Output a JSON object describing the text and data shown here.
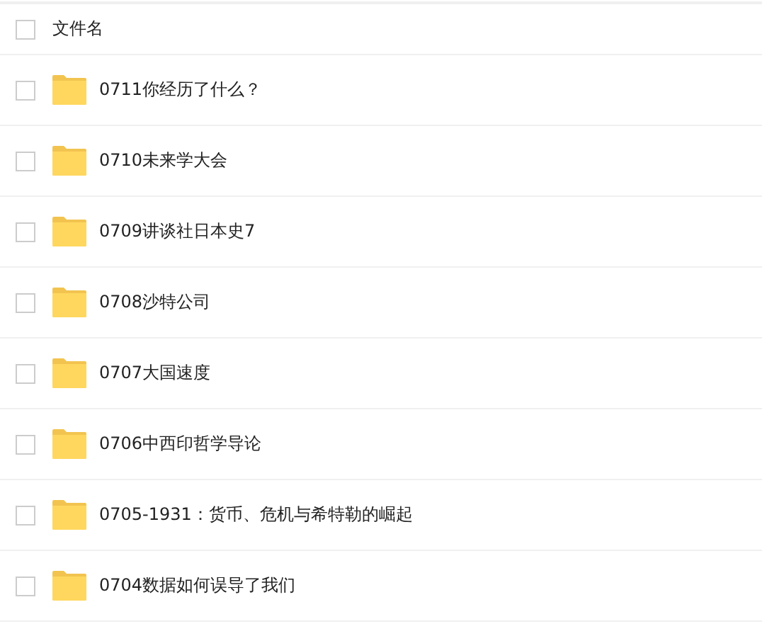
{
  "header": {
    "label": "文件名",
    "checked": false
  },
  "files": [
    {
      "name": "0711你经历了什么？",
      "checked": false
    },
    {
      "name": "0710未来学大会",
      "checked": false
    },
    {
      "name": "0709讲谈社日本史7",
      "checked": false
    },
    {
      "name": "0708沙特公司",
      "checked": false
    },
    {
      "name": "0707大国速度",
      "checked": false
    },
    {
      "name": "0706中西印哲学导论",
      "checked": false
    },
    {
      "name": "0705-1931：货币、危机与希特勒的崛起",
      "checked": false
    },
    {
      "name": "0704数据如何误导了我们",
      "checked": false
    }
  ]
}
